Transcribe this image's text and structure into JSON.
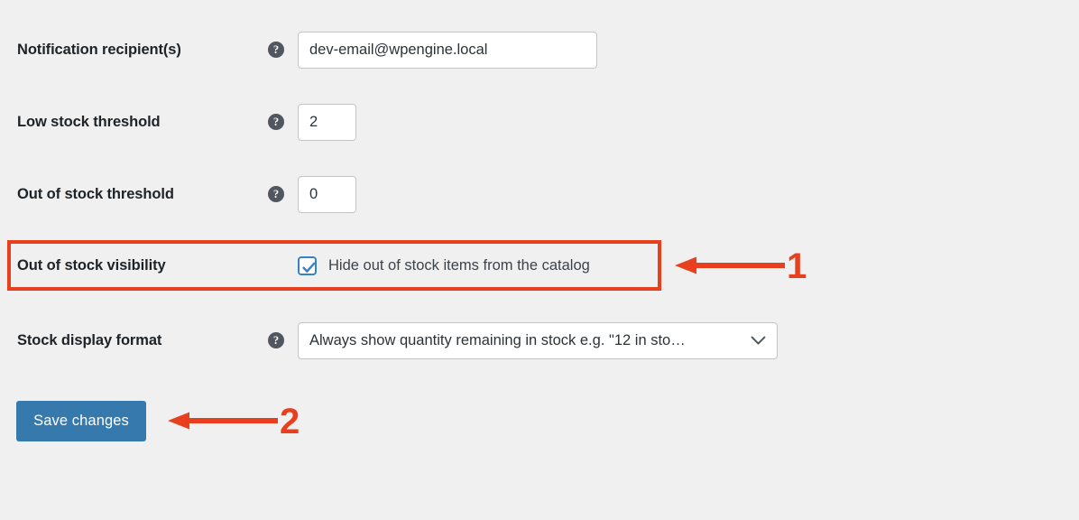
{
  "theme": {
    "page_background": "#f0f0f1",
    "label_color": "#1d2327",
    "input_border": "#c3c4c7",
    "accent_blue": "#3582c4",
    "button_blue": "#3579ad",
    "annotation_red": "#e8401f"
  },
  "form": {
    "rows": [
      {
        "label": "Notification recipient(s)",
        "help_icon": "help-circle-icon",
        "control": "text",
        "value": "dev-email@wpengine.local",
        "placeholder": ""
      },
      {
        "label": "Low stock threshold",
        "help_icon": "help-circle-icon",
        "control": "number",
        "value": "2",
        "placeholder": ""
      },
      {
        "label": "Out of stock threshold",
        "help_icon": "help-circle-icon",
        "control": "number",
        "value": "0",
        "placeholder": ""
      },
      {
        "label": "Out of stock visibility",
        "help_icon": null,
        "control": "checkbox",
        "checkbox_label": "Hide out of stock items from the catalog",
        "checked": true
      },
      {
        "label": "Stock display format",
        "help_icon": "help-circle-icon",
        "control": "select",
        "value": "Always show quantity remaining in stock e.g. \"12 in sto…",
        "dropdown_icon": "chevron-down-icon"
      }
    ],
    "help_glyph": "?"
  },
  "actions": {
    "save_label": "Save changes"
  },
  "annotations": {
    "step_one": "1",
    "step_two": "2"
  }
}
